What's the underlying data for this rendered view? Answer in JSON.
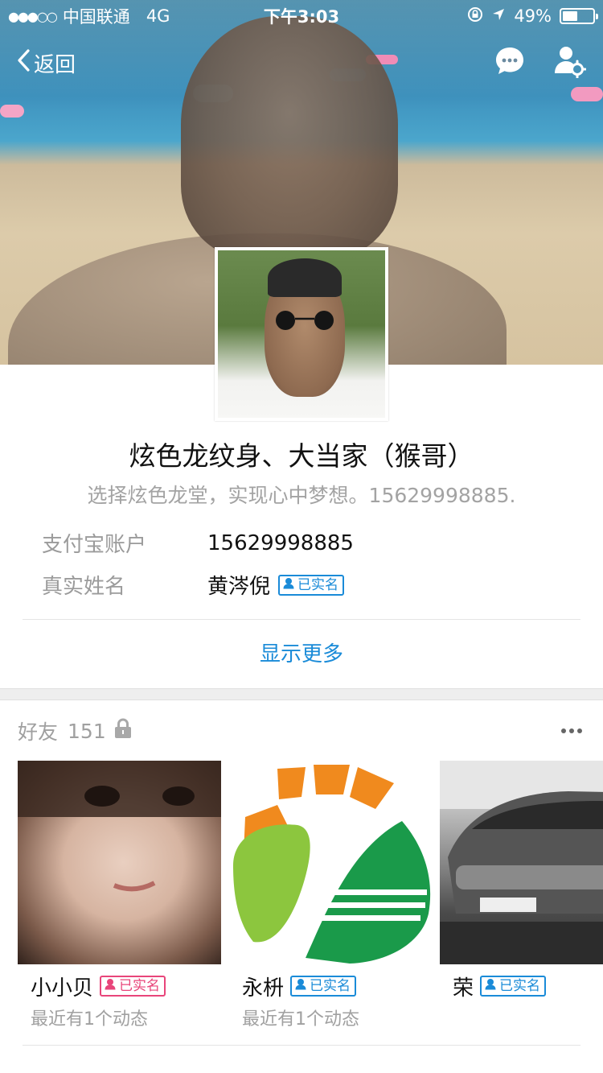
{
  "status_bar": {
    "signal": "●●●○○",
    "carrier": "中国联通",
    "network": "4G",
    "time": "下午3:03",
    "battery": "49%",
    "battery_level": 0.49
  },
  "nav": {
    "back_label": "返回"
  },
  "profile": {
    "name": "炫色龙纹身、大当家（猴哥）",
    "signature": "选择炫色龙堂，实现心中梦想。15629998885.",
    "alipay_label": "支付宝账户",
    "alipay_value": "15629998885",
    "realname_label": "真实姓名",
    "realname_value": "黄涔倪",
    "verified_label": "已实名",
    "show_more": "显示更多"
  },
  "friends": {
    "title": "好友",
    "count": "151",
    "items": [
      {
        "name": "小小贝",
        "badge": "已实名",
        "badge_color": "#e8457a",
        "status": "最近有1个动态"
      },
      {
        "name": "永枡",
        "badge": "已实名",
        "badge_color": "#1a8bd8",
        "status": "最近有1个动态"
      },
      {
        "name": "荣",
        "badge": "已实名",
        "badge_color": "#1a8bd8",
        "status": ""
      }
    ]
  },
  "colors": {
    "accent": "#1a8bd8",
    "pink": "#e8457a"
  }
}
